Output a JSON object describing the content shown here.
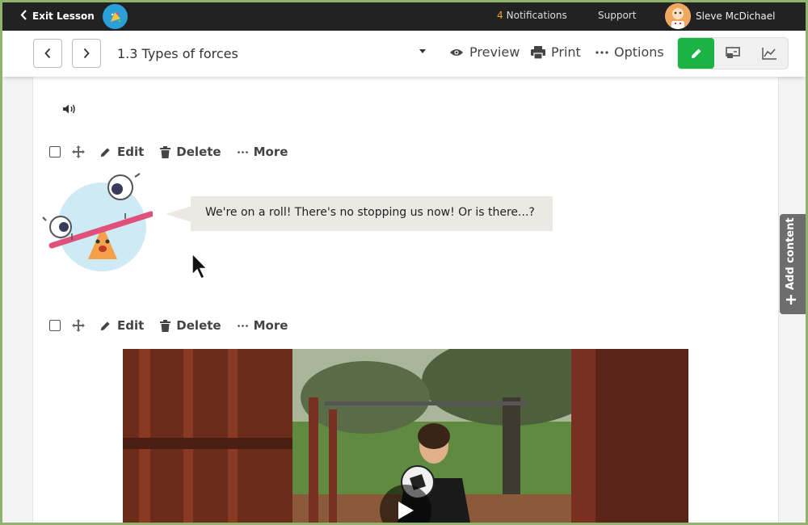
{
  "topbar": {
    "exit_label": "Exit Lesson",
    "notifications_count": "4",
    "notifications_label": "Notifications",
    "support_label": "Support",
    "user_name": "Sleve McDichael"
  },
  "toolbar": {
    "lesson_title": "1.3 Types of forces",
    "preview_label": "Preview",
    "print_label": "Print",
    "options_label": "Options"
  },
  "blocks": [
    {
      "edit_label": "Edit",
      "delete_label": "Delete",
      "more_label": "More"
    },
    {
      "edit_label": "Edit",
      "delete_label": "Delete",
      "more_label": "More"
    }
  ],
  "speech": {
    "text": "We're on a roll! There's no stopping us now! Or is there...?"
  },
  "sidebar": {
    "add_content_label": "Add content"
  },
  "colors": {
    "accent_green": "#1db344",
    "notification_orange": "#f5a623",
    "topbar": "#222222"
  }
}
